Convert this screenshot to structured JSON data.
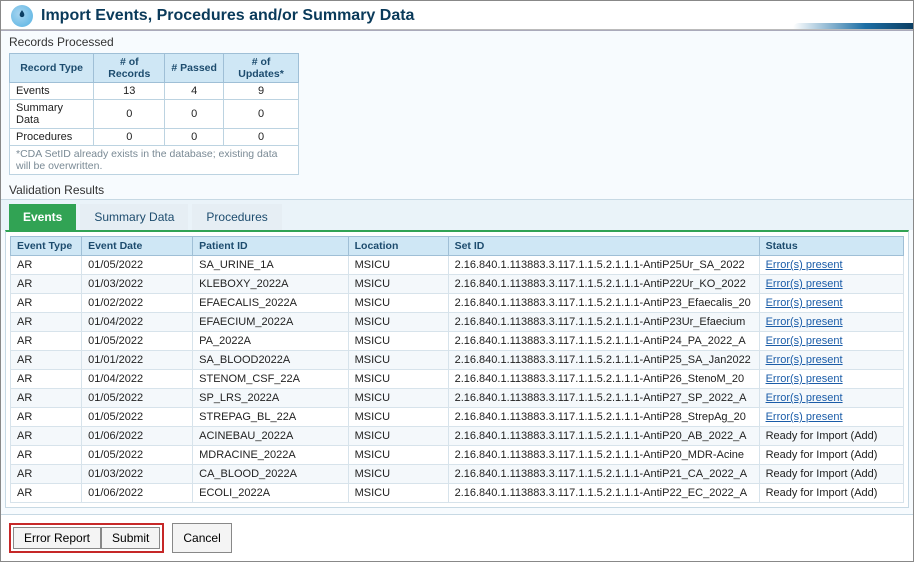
{
  "header": {
    "title": "Import Events, Procedures and/or Summary Data"
  },
  "records": {
    "heading": "Records Processed",
    "columns": [
      "Record Type",
      "# of Records",
      "# Passed",
      "# of Updates*"
    ],
    "rows": [
      {
        "type": "Events",
        "records": "13",
        "passed": "4",
        "updates": "9"
      },
      {
        "type": "Summary Data",
        "records": "0",
        "passed": "0",
        "updates": "0"
      },
      {
        "type": "Procedures",
        "records": "0",
        "passed": "0",
        "updates": "0"
      }
    ],
    "footnote": "*CDA SetID already exists in the database; existing data will be overwritten."
  },
  "validation": {
    "heading": "Validation Results",
    "tabs": [
      "Events",
      "Summary Data",
      "Procedures"
    ],
    "columns": [
      "Event Type",
      "Event Date",
      "Patient ID",
      "Location",
      "Set ID",
      "Status"
    ],
    "rows": [
      {
        "et": "AR",
        "date": "01/05/2022",
        "pid": "SA_URINE_1A",
        "loc": "MSICU",
        "setid": "2.16.840.1.113883.3.117.1.1.5.2.1.1.1-AntiP25Ur_SA_2022",
        "status": "Error(s) present",
        "link": true
      },
      {
        "et": "AR",
        "date": "01/03/2022",
        "pid": "KLEBOXY_2022A",
        "loc": "MSICU",
        "setid": "2.16.840.1.113883.3.117.1.1.5.2.1.1.1-AntiP22Ur_KO_2022",
        "status": "Error(s) present",
        "link": true
      },
      {
        "et": "AR",
        "date": "01/02/2022",
        "pid": "EFAECALIS_2022A",
        "loc": "MSICU",
        "setid": "2.16.840.1.113883.3.117.1.1.5.2.1.1.1-AntiP23_Efaecalis_20",
        "status": "Error(s) present",
        "link": true
      },
      {
        "et": "AR",
        "date": "01/04/2022",
        "pid": "EFAECIUM_2022A",
        "loc": "MSICU",
        "setid": "2.16.840.1.113883.3.117.1.1.5.2.1.1.1-AntiP23Ur_Efaecium",
        "status": "Error(s) present",
        "link": true
      },
      {
        "et": "AR",
        "date": "01/05/2022",
        "pid": "PA_2022A",
        "loc": "MSICU",
        "setid": "2.16.840.1.113883.3.117.1.1.5.2.1.1.1-AntiP24_PA_2022_A",
        "status": "Error(s) present",
        "link": true
      },
      {
        "et": "AR",
        "date": "01/01/2022",
        "pid": "SA_BLOOD2022A",
        "loc": "MSICU",
        "setid": "2.16.840.1.113883.3.117.1.1.5.2.1.1.1-AntiP25_SA_Jan2022",
        "status": "Error(s) present",
        "link": true
      },
      {
        "et": "AR",
        "date": "01/04/2022",
        "pid": "STENOM_CSF_22A",
        "loc": "MSICU",
        "setid": "2.16.840.1.113883.3.117.1.1.5.2.1.1.1-AntiP26_StenoM_20",
        "status": "Error(s) present",
        "link": true
      },
      {
        "et": "AR",
        "date": "01/05/2022",
        "pid": "SP_LRS_2022A",
        "loc": "MSICU",
        "setid": "2.16.840.1.113883.3.117.1.1.5.2.1.1.1-AntiP27_SP_2022_A",
        "status": "Error(s) present",
        "link": true
      },
      {
        "et": "AR",
        "date": "01/05/2022",
        "pid": "STREPAG_BL_22A",
        "loc": "MSICU",
        "setid": "2.16.840.1.113883.3.117.1.1.5.2.1.1.1-AntiP28_StrepAg_20",
        "status": "Error(s) present",
        "link": true
      },
      {
        "et": "AR",
        "date": "01/06/2022",
        "pid": "ACINEBAU_2022A",
        "loc": "MSICU",
        "setid": "2.16.840.1.113883.3.117.1.1.5.2.1.1.1-AntiP20_AB_2022_A",
        "status": "Ready for Import (Add)",
        "link": false
      },
      {
        "et": "AR",
        "date": "01/05/2022",
        "pid": "MDRACINE_2022A",
        "loc": "MSICU",
        "setid": "2.16.840.1.113883.3.117.1.1.5.2.1.1.1-AntiP20_MDR-Acine",
        "status": "Ready for Import (Add)",
        "link": false
      },
      {
        "et": "AR",
        "date": "01/03/2022",
        "pid": "CA_BLOOD_2022A",
        "loc": "MSICU",
        "setid": "2.16.840.1.113883.3.117.1.1.5.2.1.1.1-AntiP21_CA_2022_A",
        "status": "Ready for Import (Add)",
        "link": false
      },
      {
        "et": "AR",
        "date": "01/06/2022",
        "pid": "ECOLI_2022A",
        "loc": "MSICU",
        "setid": "2.16.840.1.113883.3.117.1.1.5.2.1.1.1-AntiP22_EC_2022_A",
        "status": "Ready for Import (Add)",
        "link": false
      }
    ]
  },
  "footer": {
    "error_report": "Error Report",
    "submit": "Submit",
    "cancel": "Cancel"
  }
}
